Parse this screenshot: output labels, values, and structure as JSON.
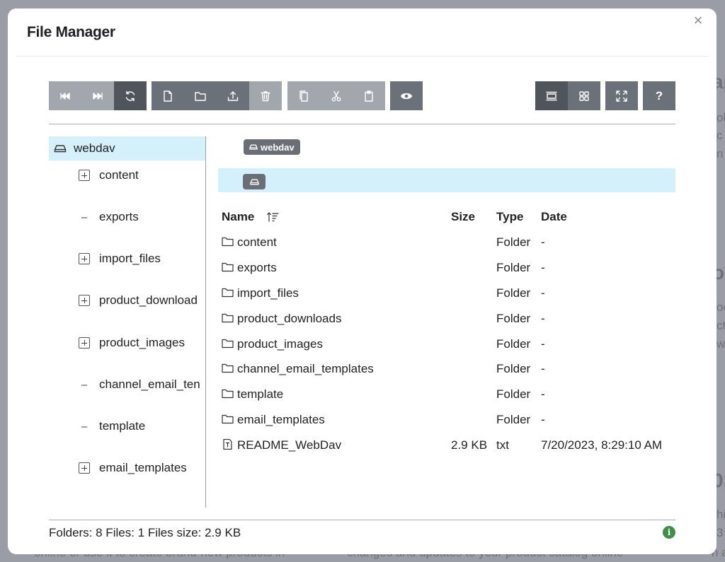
{
  "modal": {
    "title": "File Manager",
    "close_glyph": "×"
  },
  "toolbar": {
    "groups": [
      {
        "name": "navigation",
        "buttons": [
          "back-icon",
          "forward-icon",
          "refresh-icon"
        ]
      },
      {
        "name": "create",
        "buttons": [
          "new-file-icon",
          "new-folder-icon",
          "upload-icon",
          "delete-icon"
        ]
      },
      {
        "name": "clipboard",
        "buttons": [
          "copy-icon",
          "cut-icon",
          "paste-icon"
        ]
      },
      {
        "name": "preview",
        "buttons": [
          "eye-icon"
        ]
      },
      {
        "name": "view",
        "buttons": [
          "list-view-icon",
          "grid-view-icon"
        ]
      },
      {
        "name": "fullscreen",
        "buttons": [
          "fullscreen-icon"
        ]
      },
      {
        "name": "help",
        "buttons": [
          "help-icon"
        ]
      }
    ],
    "help_label": "?"
  },
  "tree": {
    "root": {
      "label": "webdav",
      "icon": "drive-icon"
    },
    "items": [
      {
        "label": "content",
        "expandable": true
      },
      {
        "label": "exports",
        "expandable": false
      },
      {
        "label": "import_files",
        "expandable": true
      },
      {
        "label": "product_download",
        "expandable": true
      },
      {
        "label": "product_images",
        "expandable": true
      },
      {
        "label": "channel_email_ten",
        "expandable": false
      },
      {
        "label": "template",
        "expandable": false
      },
      {
        "label": "email_templates",
        "expandable": true
      }
    ],
    "expand_glyph": "+",
    "collapse_glyph": "–"
  },
  "breadcrumb": {
    "label": "webdav",
    "icon": "drive-icon"
  },
  "table": {
    "headers": {
      "name": "Name",
      "size": "Size",
      "type": "Type",
      "date": "Date"
    },
    "sort_icon": "sort-ascending-icon",
    "rows": [
      {
        "icon": "folder-icon",
        "name": "content",
        "size": "",
        "type": "Folder",
        "date": "-"
      },
      {
        "icon": "folder-icon",
        "name": "exports",
        "size": "",
        "type": "Folder",
        "date": "-"
      },
      {
        "icon": "folder-icon",
        "name": "import_files",
        "size": "",
        "type": "Folder",
        "date": "-"
      },
      {
        "icon": "folder-icon",
        "name": "product_downloads",
        "size": "",
        "type": "Folder",
        "date": "-"
      },
      {
        "icon": "folder-icon",
        "name": "product_images",
        "size": "",
        "type": "Folder",
        "date": "-"
      },
      {
        "icon": "folder-icon",
        "name": "channel_email_templates",
        "size": "",
        "type": "Folder",
        "date": "-"
      },
      {
        "icon": "folder-icon",
        "name": "template",
        "size": "",
        "type": "Folder",
        "date": "-"
      },
      {
        "icon": "folder-icon",
        "name": "email_templates",
        "size": "",
        "type": "Folder",
        "date": "-"
      },
      {
        "icon": "text-file-icon",
        "name": "README_WebDav",
        "size": "2.9 KB",
        "type": "txt",
        "date": "7/20/2023, 8:29:10 AM"
      }
    ]
  },
  "status": {
    "text": "Folders: 8 Files: 1 Files size: 2.9 KB",
    "info_glyph": "i"
  },
  "background": {
    "fragments": [
      "ap",
      "ol",
      "c",
      "n",
      "ov",
      "od",
      "ct",
      "wi",
      "01",
      "hi",
      "3",
      "n a",
      "online or use it to create brand-new products in",
      "changes and updates to your product catalog online"
    ]
  },
  "colors": {
    "selection": "#d4f0fa",
    "toolbar_light": "#a2a7ae",
    "toolbar_dark": "#6b7178",
    "toolbar_active": "#50555b",
    "info": "#3f8f48"
  }
}
